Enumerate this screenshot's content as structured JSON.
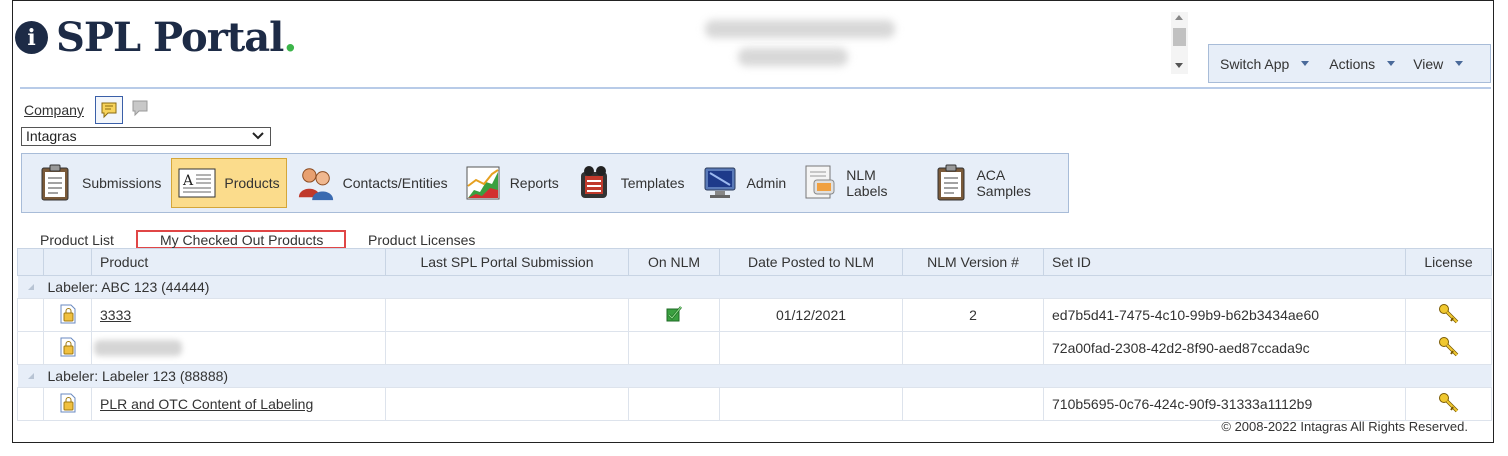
{
  "app": {
    "logo_text": "SPL Portal",
    "logo_letter": "i",
    "logo_dot": ".",
    "brand_color": "#1d2b46",
    "accent_color": "#3cb54a"
  },
  "menu": {
    "items": [
      {
        "label": "Switch App"
      },
      {
        "label": "Actions"
      },
      {
        "label": "View"
      }
    ]
  },
  "company": {
    "link_label": "Company",
    "selected": "Intagras",
    "icons": [
      "comment-active-icon",
      "comment-gray-icon"
    ]
  },
  "toolbar": {
    "items": [
      {
        "label": "Submissions",
        "icon": "clipboard-icon"
      },
      {
        "label": "Products",
        "icon": "document-a-icon",
        "active": true
      },
      {
        "label": "Contacts/Entities",
        "icon": "people-icon"
      },
      {
        "label": "Reports",
        "icon": "chart-icon"
      },
      {
        "label": "Templates",
        "icon": "film-reel-icon"
      },
      {
        "label": "Admin",
        "icon": "monitor-icon"
      },
      {
        "label": "NLM Labels",
        "icon": "label-document-icon"
      },
      {
        "label": "ACA Samples",
        "icon": "clipboard-icon"
      }
    ]
  },
  "tabs": [
    {
      "label": "Product List"
    },
    {
      "label": "My Checked Out Products",
      "selected": true
    },
    {
      "label": "Product Licenses"
    }
  ],
  "grid": {
    "columns": [
      "Product",
      "Last SPL Portal Submission",
      "On NLM",
      "Date Posted to NLM",
      "NLM Version #",
      "Set ID",
      "License"
    ],
    "groups": [
      {
        "label": "Labeler: ABC 123 (44444)",
        "rows": [
          {
            "product": "3333",
            "last_submission": "",
            "on_nlm": true,
            "date_posted": "01/12/2021",
            "nlm_version": "2",
            "set_id": "ed7b5d41-7475-4c10-99b9-b62b3434ae60"
          },
          {
            "product": "",
            "last_submission": "",
            "on_nlm": false,
            "date_posted": "",
            "nlm_version": "",
            "set_id": "72a00fad-2308-42d2-8f90-aed87ccada9c"
          }
        ]
      },
      {
        "label": "Labeler: Labeler 123 (88888)",
        "rows": [
          {
            "product": "PLR and OTC Content of Labeling",
            "last_submission": "",
            "on_nlm": false,
            "date_posted": "",
            "nlm_version": "",
            "set_id": "710b5695-0c76-424c-90f9-31333a1112b9"
          }
        ]
      }
    ]
  },
  "footer": {
    "copyright": "© 2008-2022 Intagras All Rights Reserved."
  }
}
